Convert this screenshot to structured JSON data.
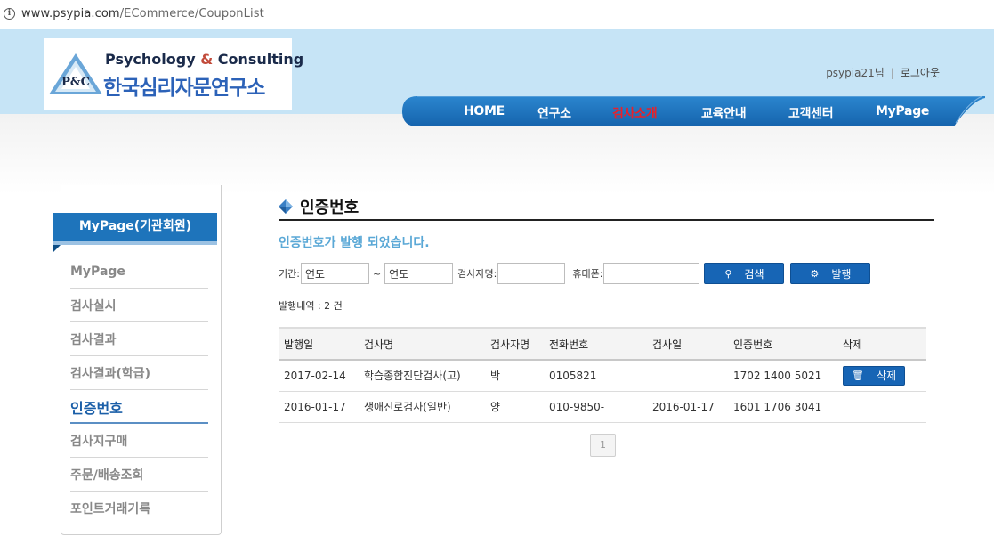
{
  "browser": {
    "url_host": "www.psypia.com",
    "url_path": "/ECommerce/CouponList"
  },
  "logo": {
    "badge": "P&C",
    "english_part1": "Psychology",
    "english_amp": "&",
    "english_part2": "Consulting",
    "korean": "한국심리자문연구소"
  },
  "user": {
    "name": "psypia21님",
    "separator": "|",
    "logout": "로그아웃"
  },
  "nav": {
    "items": [
      {
        "label": "HOME"
      },
      {
        "label": "연구소"
      },
      {
        "label": "검사소개"
      },
      {
        "label": "교육안내"
      },
      {
        "label": "고객센터"
      },
      {
        "label": "MyPage"
      }
    ],
    "active_index": 2,
    "active_color": "#e8212a",
    "bar_color": "#1e74bb"
  },
  "sidebar": {
    "title": "MyPage(기관회원)",
    "items": [
      {
        "label": "MyPage"
      },
      {
        "label": "검사실시"
      },
      {
        "label": "검사결과"
      },
      {
        "label": "검사결과(학급)"
      },
      {
        "label": "인증번호"
      },
      {
        "label": "검사지구매"
      },
      {
        "label": "주문/배송조회"
      },
      {
        "label": "포인트거래기록"
      }
    ],
    "active_index": 4
  },
  "main": {
    "title": "인증번호",
    "notice": "인증번호가 발행 되었습니다.",
    "search": {
      "period_label": "기간:",
      "from_value": "연도",
      "tilde": "~",
      "to_value": "연도",
      "examinee_label": "검사자명:",
      "examinee_value": "",
      "phone_label": "휴대폰:",
      "phone_value": "",
      "search_button": "검색",
      "issue_button": "발행"
    },
    "count_text": "발행내역 : 2 건",
    "table": {
      "headers": [
        "발행일",
        "검사명",
        "검사자명",
        "전화번호",
        "검사일",
        "인증번호",
        "삭제"
      ],
      "rows": [
        {
          "issued": "2017-02-14",
          "test": "학습종합진단검사(고)",
          "examinee": "박",
          "phone": "0105821",
          "test_date": "",
          "code": "1702 1400 5021",
          "delete": "삭제"
        },
        {
          "issued": "2016-01-17",
          "test": "생애진로검사(일반)",
          "examinee": "양",
          "phone": "010-9850-",
          "test_date": "2016-01-17",
          "code": "1601 1706 3041",
          "delete": ""
        }
      ]
    },
    "pagination": {
      "current": "1"
    }
  }
}
